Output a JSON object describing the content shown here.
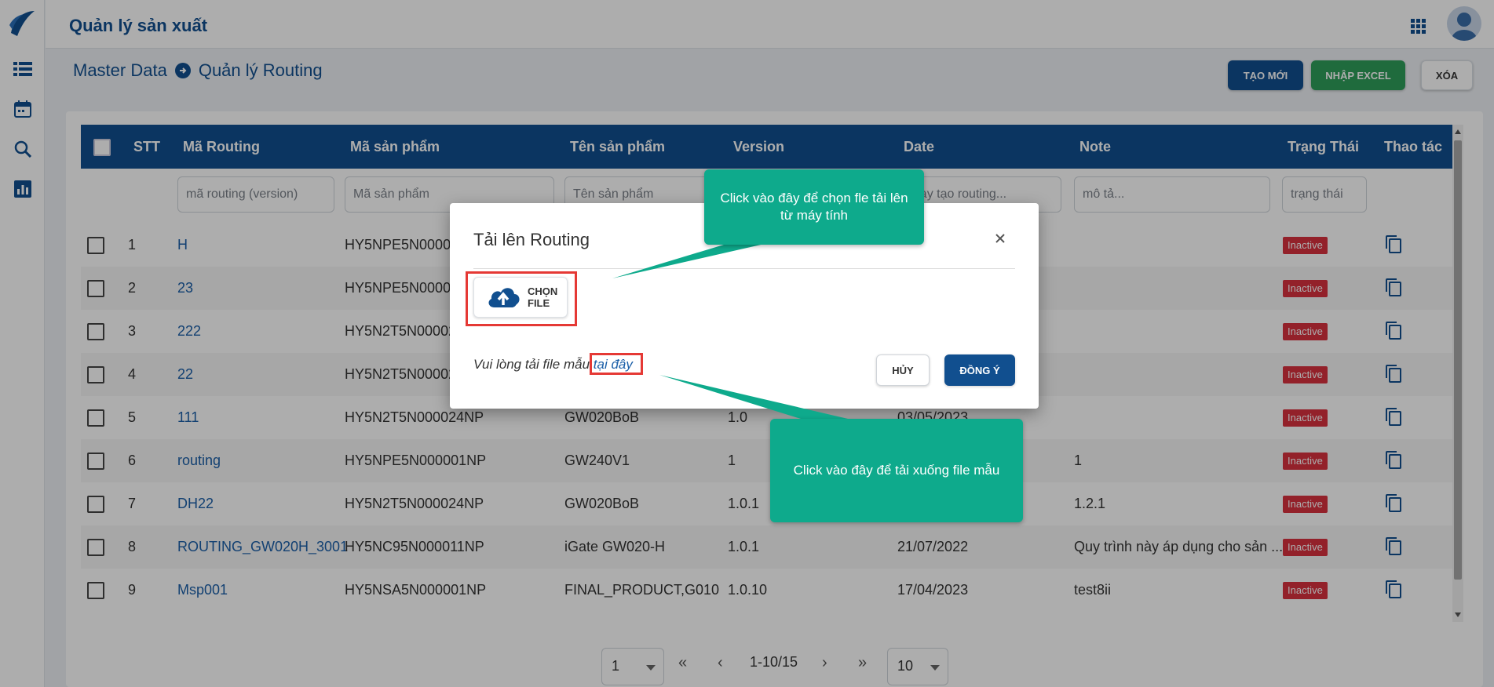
{
  "app": {
    "title": "Quản lý sản xuất"
  },
  "sidebar": {
    "items": [
      {
        "icon": "list-icon"
      },
      {
        "icon": "calendar-icon"
      },
      {
        "icon": "search-icon"
      },
      {
        "icon": "bar-chart-icon"
      }
    ]
  },
  "breadcrumb": {
    "root": "Master Data",
    "current": "Quản lý Routing"
  },
  "toolbar": {
    "create_label": "TẠO MỚI",
    "import_label": "NHẬP EXCEL",
    "delete_label": "XÓA"
  },
  "table": {
    "headers": {
      "stt": "STT",
      "routing_code": "Mã Routing",
      "product_code": "Mã sản phẩm",
      "product_name": "Tên sản phẩm",
      "version": "Version",
      "date": "Date",
      "note": "Note",
      "status": "Trạng Thái",
      "actions": "Thao tác"
    },
    "filters": {
      "routing_code": "mã routing (version)",
      "product_code": "Mã sản phẩm",
      "product_name": "Tên sản phẩm",
      "date": "ngày tạo routing...",
      "note": "mô tả...",
      "status": "trạng thái"
    },
    "rows": [
      {
        "stt": "1",
        "code": "H",
        "product_code": "HY5NPE5N00000",
        "product_name": "",
        "version": "",
        "date": "",
        "note": "",
        "status": "Inactive"
      },
      {
        "stt": "2",
        "code": "23",
        "product_code": "HY5NPE5N00000",
        "product_name": "",
        "version": "",
        "date": "",
        "note": "",
        "status": "Inactive"
      },
      {
        "stt": "3",
        "code": "222",
        "product_code": "HY5N2T5N00002",
        "product_name": "",
        "version": "",
        "date": "",
        "note": "",
        "status": "Inactive"
      },
      {
        "stt": "4",
        "code": "22",
        "product_code": "HY5N2T5N00002",
        "product_name": "",
        "version": "",
        "date": "",
        "note": "",
        "status": "Inactive"
      },
      {
        "stt": "5",
        "code": "111",
        "product_code": "HY5N2T5N000024NP",
        "product_name": "GW020BoB",
        "version": "1.0",
        "date": "03/05/2023",
        "note": "",
        "status": "Inactive"
      },
      {
        "stt": "6",
        "code": "routing",
        "product_code": "HY5NPE5N000001NP",
        "product_name": "GW240V1",
        "version": "1",
        "date": "",
        "note": "1",
        "status": "Inactive"
      },
      {
        "stt": "7",
        "code": "DH22",
        "product_code": "HY5N2T5N000024NP",
        "product_name": "GW020BoB",
        "version": "1.0.1",
        "date": "",
        "note": "1.2.1",
        "status": "Inactive"
      },
      {
        "stt": "8",
        "code": "ROUTING_GW020H_3001",
        "product_code": "HY5NC95N000011NP",
        "product_name": "iGate GW020-H",
        "version": "1.0.1",
        "date": "21/07/2022",
        "note": "Quy trình này áp dụng cho sản ...",
        "status": "Inactive"
      },
      {
        "stt": "9",
        "code": "Msp001",
        "product_code": "HY5NSA5N000001NP",
        "product_name": "FINAL_PRODUCT,G010",
        "version": "1.0.10",
        "date": "17/04/2023",
        "note": "test8ii",
        "status": "Inactive"
      }
    ]
  },
  "pagination": {
    "page": "1",
    "first": "«",
    "prev": "‹",
    "range": "1-10/15",
    "next": "›",
    "last": "»",
    "page_size": "10"
  },
  "dialog": {
    "title": "Tải lên Routing",
    "choose_file_label": "CHỌN FILE",
    "hint_text": "Vui lòng tải file mẫu ",
    "hint_link": "tại đây",
    "cancel_label": "HỦY",
    "ok_label": "ĐỒNG Ý"
  },
  "callouts": {
    "choose_file": "Click vào đây để chọn fle tải lên từ máy tính",
    "download_template": "Click vào đây để tải xuống file mẫu"
  },
  "colors": {
    "primary": "#114f8f",
    "success": "#2e9e5b",
    "danger": "#d9313f",
    "callout": "#0eaa8c"
  }
}
